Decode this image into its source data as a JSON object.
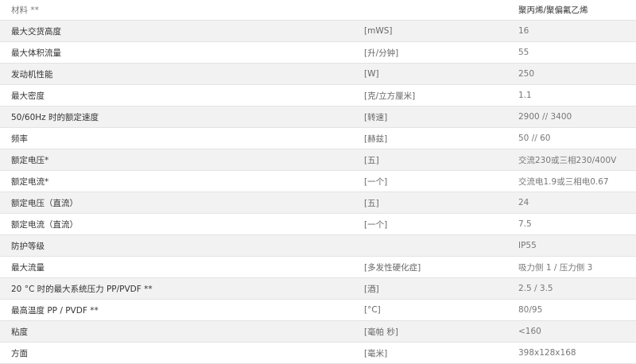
{
  "specs": {
    "rows": [
      {
        "name": "材料 **",
        "unit": "",
        "value": "聚丙烯/聚偏氟乙烯"
      },
      {
        "name": "最大交货高度",
        "unit": "[mWS]",
        "value": "16"
      },
      {
        "name": "最大体积流量",
        "unit": "[升/分钟]",
        "value": "55"
      },
      {
        "name": "发动机性能",
        "unit": "[W]",
        "value": "250"
      },
      {
        "name": "最大密度",
        "unit": "[克/立方厘米]",
        "value": "1.1"
      },
      {
        "name": "50/60Hz 时的额定速度",
        "unit": "[转速]",
        "value": "2900 // 3400"
      },
      {
        "name": "频率",
        "unit": "[赫兹]",
        "value": "50 // 60"
      },
      {
        "name": "额定电压*",
        "unit": "[五]",
        "value": "交流230或三相230/400V"
      },
      {
        "name": "额定电流*",
        "unit": "[一个]",
        "value": "交流电1.9或三相电0.67"
      },
      {
        "name": "额定电压（直流）",
        "unit": "[五]",
        "value": "24"
      },
      {
        "name": "额定电流（直流）",
        "unit": "[一个]",
        "value": "7.5"
      },
      {
        "name": "防护等级",
        "unit": "",
        "value": "IP55"
      },
      {
        "name": "最大流量",
        "unit": "[多发性硬化症]",
        "value": "吸力侧 1 / 压力侧 3"
      },
      {
        "name": "20 °C 时的最大系统压力 PP/PVDF **",
        "unit": "[酒]",
        "value": "2.5 / 3.5"
      },
      {
        "name": "最高温度 PP / PVDF **",
        "unit": "[°C]",
        "value": "80/95"
      },
      {
        "name": "粘度",
        "unit": "[毫帕 秒]",
        "value": "<160"
      },
      {
        "name": "方面",
        "unit": "[毫米]",
        "value": "398x128x168"
      }
    ]
  }
}
